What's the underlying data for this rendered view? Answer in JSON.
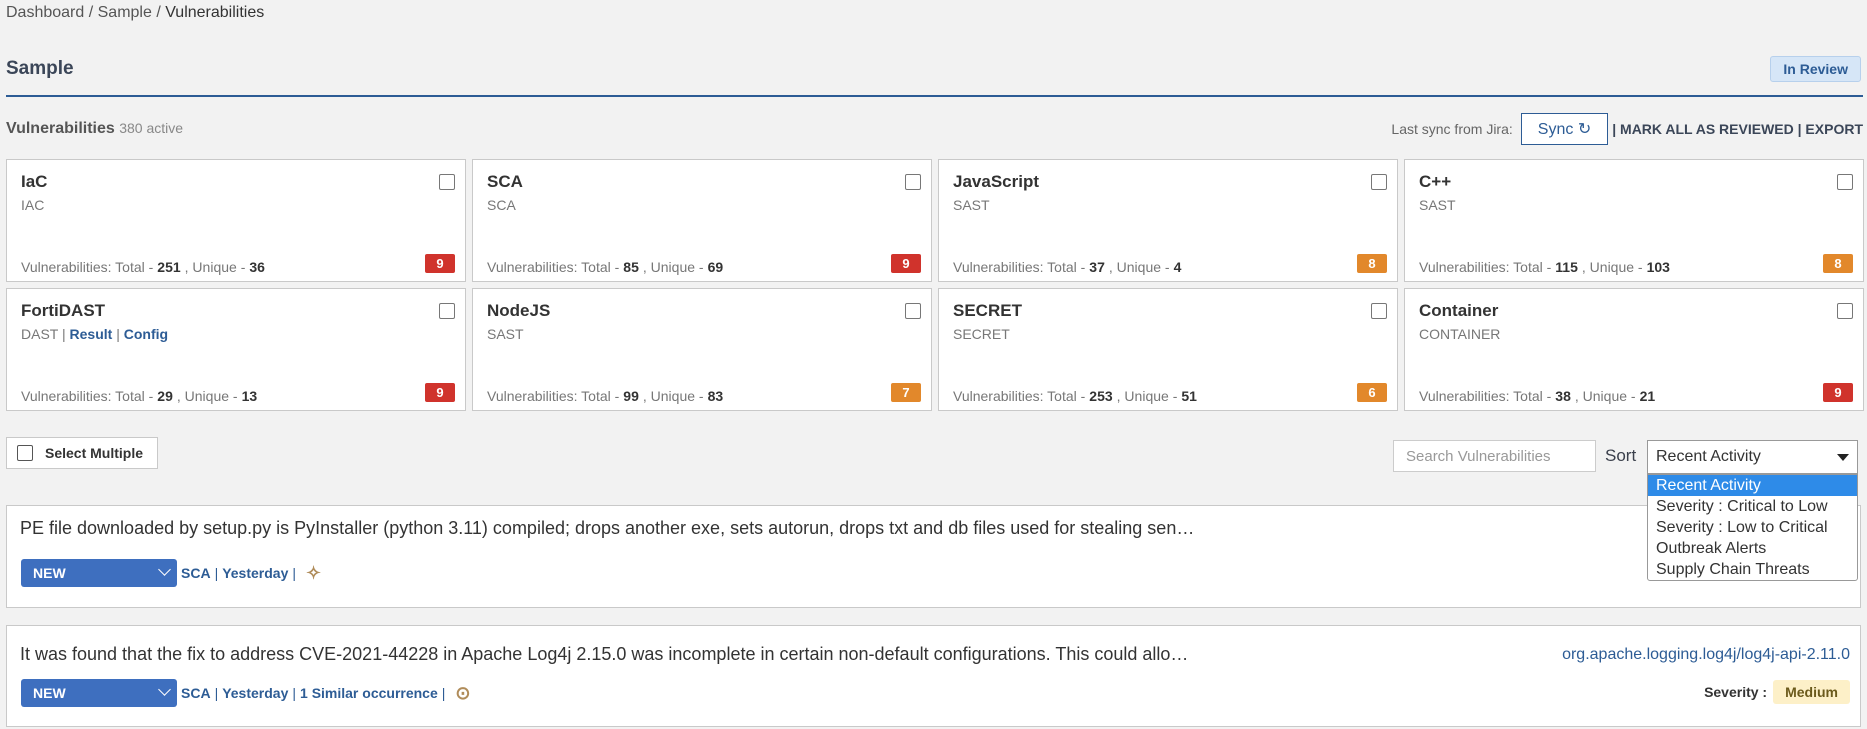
{
  "breadcrumb": {
    "items": [
      "Dashboard",
      "Sample"
    ],
    "sep": " / ",
    "current": "Vulnerabilities"
  },
  "page": {
    "title": "Sample",
    "status": "In Review"
  },
  "vulns_header": {
    "label": "Vulnerabilities",
    "count": "380 active"
  },
  "sync": {
    "label": "Last sync from Jira:",
    "button": "Sync",
    "actions": "| MARK ALL AS REVIEWED | EXPORT"
  },
  "cards": [
    {
      "name": "IaC",
      "type": "IAC",
      "total": "251",
      "unique": "36",
      "badge": "9",
      "badge_color": "#d0332c"
    },
    {
      "name": "SCA",
      "type": "SCA",
      "total": "85",
      "unique": "69",
      "badge": "9",
      "badge_color": "#d0332c"
    },
    {
      "name": "JavaScript",
      "type": "SAST",
      "total": "37",
      "unique": "4",
      "badge": "8",
      "badge_color": "#e2882b"
    },
    {
      "name": "C++",
      "type": "SAST",
      "total": "115",
      "unique": "103",
      "badge": "8",
      "badge_color": "#e2882b"
    },
    {
      "name": "FortiDAST",
      "type": "DAST",
      "links": [
        "Result",
        "Config"
      ],
      "total": "29",
      "unique": "13",
      "badge": "9",
      "badge_color": "#d0332c"
    },
    {
      "name": "NodeJS",
      "type": "SAST",
      "total": "99",
      "unique": "83",
      "badge": "7",
      "badge_color": "#e2882b"
    },
    {
      "name": "SECRET",
      "type": "SECRET",
      "total": "253",
      "unique": "51",
      "badge": "6",
      "badge_color": "#e2882b"
    },
    {
      "name": "Container",
      "type": "CONTAINER",
      "total": "38",
      "unique": "21",
      "badge": "9",
      "badge_color": "#d0332c"
    }
  ],
  "stat_labels": {
    "total": "Vulnerabilities: Total -",
    "unique": ", Unique -"
  },
  "select_multiple": "Select Multiple",
  "search": {
    "placeholder": "Search Vulnerabilities"
  },
  "sort": {
    "label": "Sort",
    "selected": "Recent Activity",
    "options": [
      "Recent Activity",
      "Severity : Critical to Low",
      "Severity : Low to Critical",
      "Outbreak Alerts",
      "Supply Chain Threats"
    ]
  },
  "rows": [
    {
      "title": "PE file downloaded by setup.py is PyInstaller (python 3.11) compiled; drops another exe, sets autorun, drops txt and db files used for stealing sen…",
      "status": "NEW",
      "meta": [
        "SCA",
        "Yesterday"
      ],
      "peek": ">"
    },
    {
      "title": "It was found that the fix to address CVE-2021-44228 in Apache Log4j 2.15.0 was incomplete in certain non-default configurations. This could allo…",
      "status": "NEW",
      "meta": [
        "SCA",
        "Yesterday",
        "1 Similar occurrence"
      ],
      "package": "org.apache.logging.log4j/log4j-api-2.11.0",
      "severity_label": "Severity :",
      "severity": "Medium"
    }
  ]
}
